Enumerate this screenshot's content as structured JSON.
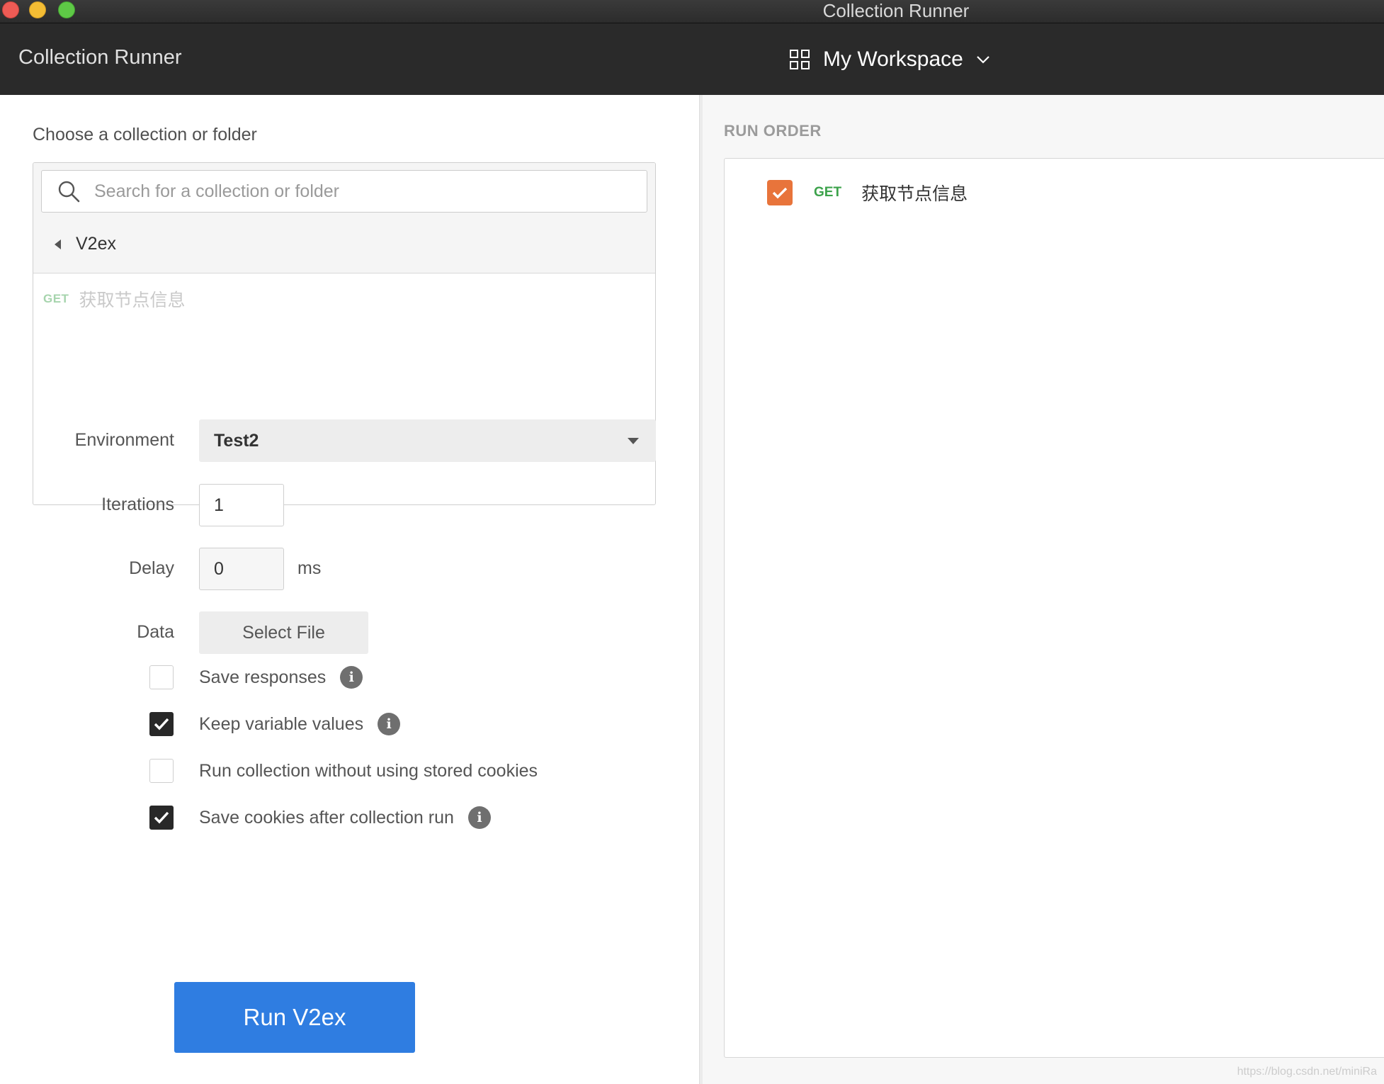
{
  "window": {
    "title": "Collection Runner"
  },
  "appbar": {
    "title": "Collection Runner",
    "workspace": "My Workspace"
  },
  "collection": {
    "choose_label": "Choose a collection or folder",
    "search_placeholder": "Search for a collection or folder",
    "root": "V2ex",
    "requests": [
      {
        "method": "GET",
        "name": "获取节点信息"
      }
    ]
  },
  "form": {
    "environment_label": "Environment",
    "environment_value": "Test2",
    "iterations_label": "Iterations",
    "iterations_value": "1",
    "delay_label": "Delay",
    "delay_value": "0",
    "delay_unit": "ms",
    "data_label": "Data",
    "select_file_label": "Select File"
  },
  "options": [
    {
      "label": "Save responses",
      "checked": false,
      "info": true
    },
    {
      "label": "Keep variable values",
      "checked": true,
      "info": true
    },
    {
      "label": "Run collection without using stored cookies",
      "checked": false,
      "info": false
    },
    {
      "label": "Save cookies after collection run",
      "checked": true,
      "info": true
    }
  ],
  "run_button": {
    "label": "Run V2ex"
  },
  "run_order": {
    "label": "RUN ORDER",
    "items": [
      {
        "method": "GET",
        "name": "获取节点信息",
        "checked": true
      }
    ]
  },
  "watermark": "https://blog.csdn.net/miniRa",
  "colors": {
    "accent": "#2f7de1",
    "get_method": "#3ca24b",
    "run_order_check": "#e8743b",
    "appbar": "#2a2a2a"
  },
  "icons": {
    "search": "search-icon",
    "workspace": "grid-icon",
    "info": "info-icon",
    "check": "checkmark-icon"
  }
}
